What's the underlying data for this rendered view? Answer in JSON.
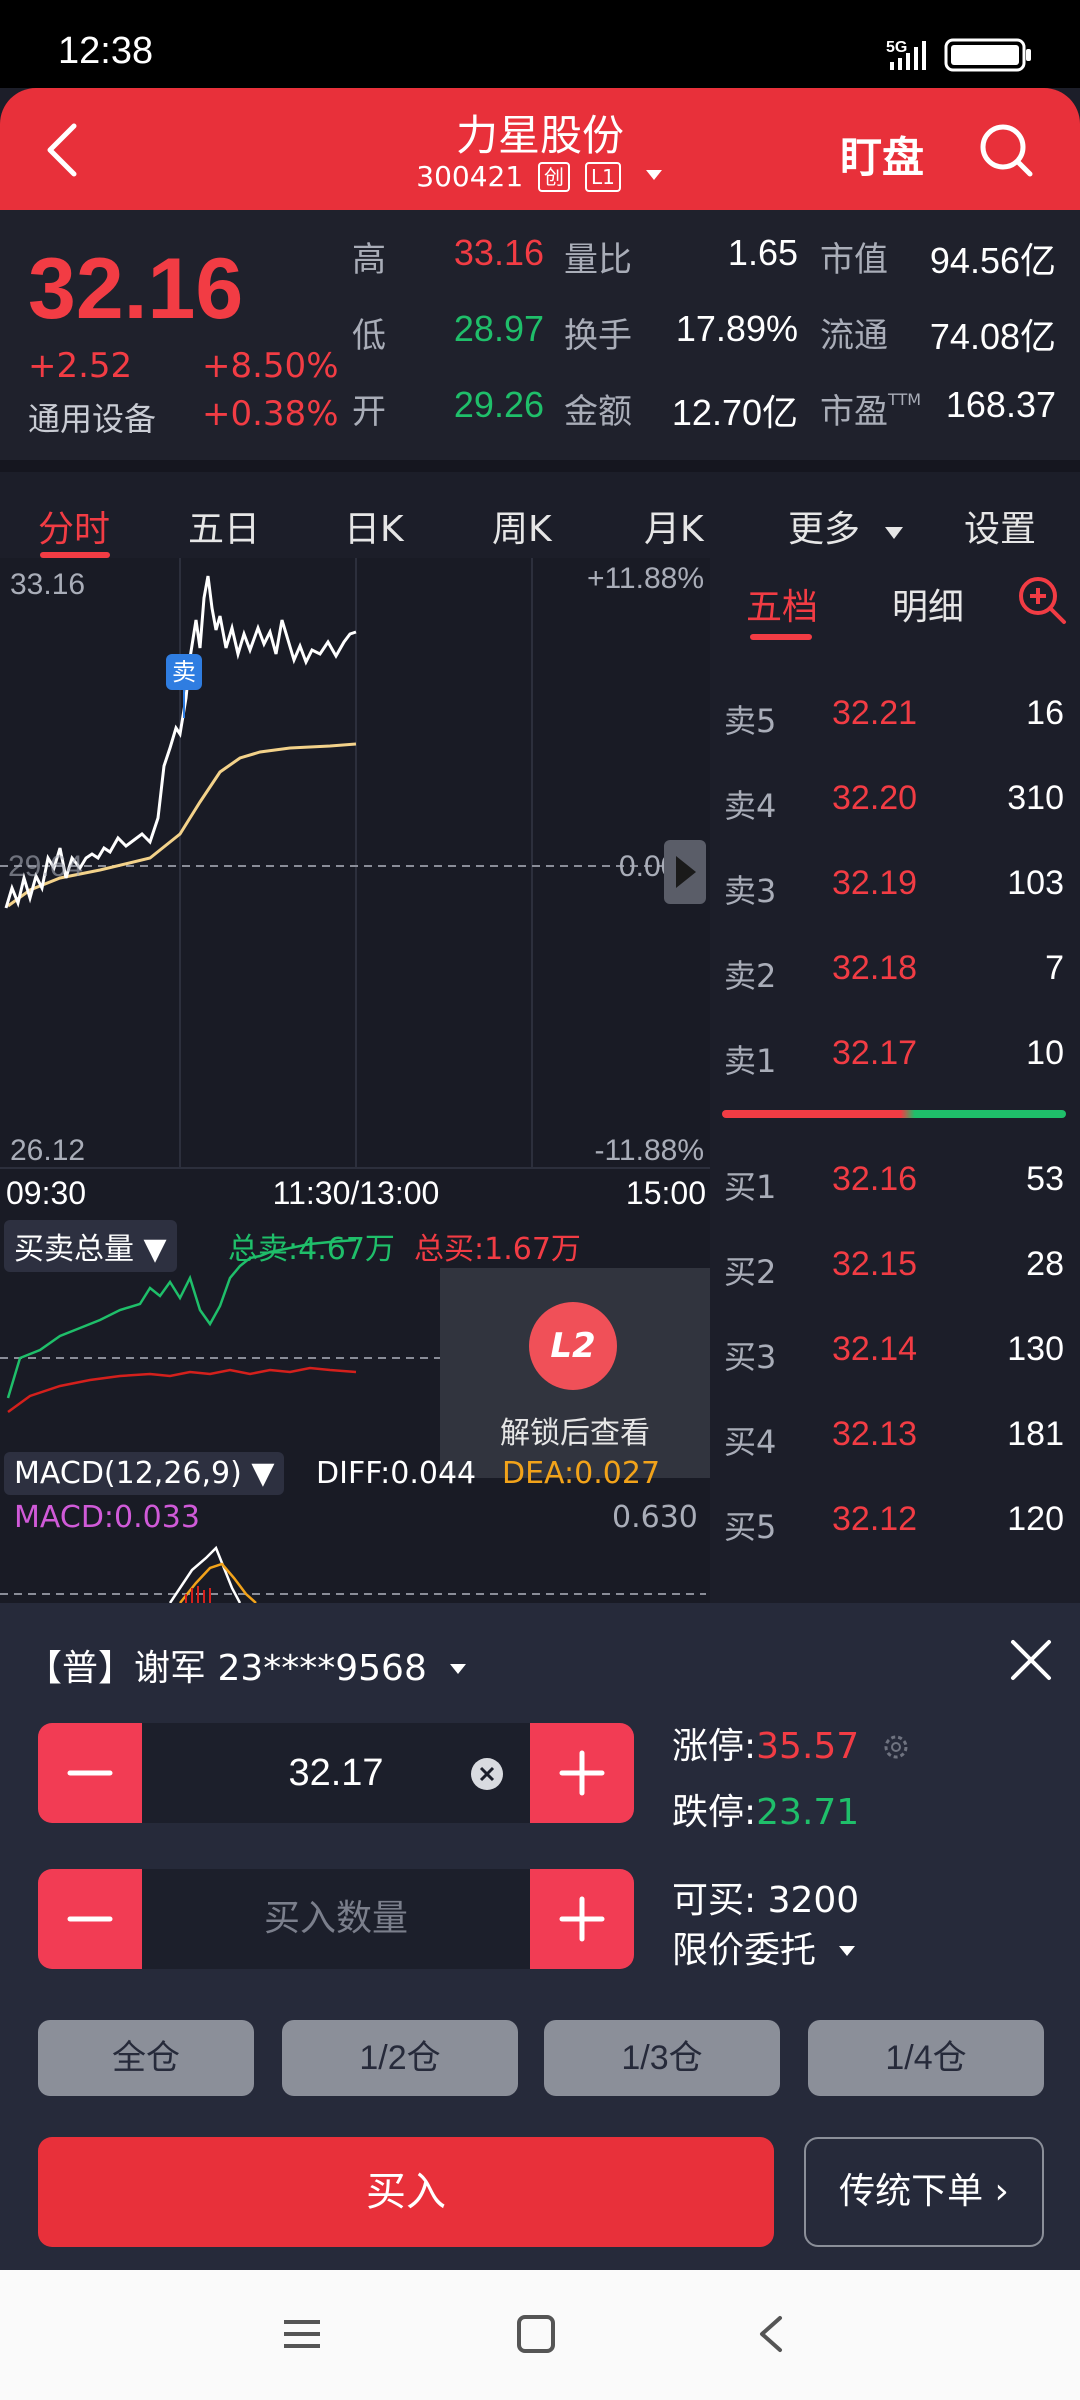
{
  "status_bar": {
    "time": "12:38",
    "network": "5G"
  },
  "header": {
    "stock_name": "力星股份",
    "stock_code": "300421",
    "tag1": "创",
    "tag2": "L1",
    "watch_label": "盯盘"
  },
  "quote": {
    "last_price": "32.16",
    "change_abs": "+2.52",
    "change_pct": "+8.50%",
    "sector_name": "通用设备",
    "sector_pct": "+0.38%",
    "rows": [
      [
        {
          "label": "高",
          "value": "33.16",
          "color": "red"
        },
        {
          "label": "量比",
          "value": "1.65",
          "color": "white"
        },
        {
          "label": "市值",
          "value": "94.56亿",
          "color": "white"
        }
      ],
      [
        {
          "label": "低",
          "value": "28.97",
          "color": "green"
        },
        {
          "label": "换手",
          "value": "17.89%",
          "color": "white"
        },
        {
          "label": "流通",
          "value": "74.08亿",
          "color": "white"
        }
      ],
      [
        {
          "label": "开",
          "value": "29.26",
          "color": "green"
        },
        {
          "label": "金额",
          "value": "12.70亿",
          "color": "white"
        },
        {
          "label": "市盈",
          "value": "168.37",
          "color": "white"
        }
      ]
    ],
    "pe_suffix": "TTM"
  },
  "tabs": [
    "分时",
    "五日",
    "日K",
    "周K",
    "月K",
    "更多",
    "设置"
  ],
  "chart": {
    "price_high": "33.16",
    "price_low": "26.12",
    "pct_high": "+11.88%",
    "pct_zero": "0.00%",
    "pct_low": "-11.88%",
    "price_ref": "29.64",
    "time_start": "09:30",
    "time_mid": "11:30/13:00",
    "time_end": "15:00",
    "sell_marker": "卖",
    "volume_indicator": "买卖总量",
    "total_sell": "总卖:4.67万",
    "total_buy": "总买:1.67万",
    "lock_badge": "L2",
    "lock_text": "解锁后查看",
    "macd_label": "MACD(12,26,9)",
    "diff": "DIFF:0.044",
    "dea": "DEA:0.027",
    "macd": "MACD:0.033",
    "macd_max": "0.630"
  },
  "order_book": {
    "tab_five": "五档",
    "tab_detail": "明细",
    "asks": [
      {
        "label": "卖5",
        "price": "32.21",
        "vol": "16"
      },
      {
        "label": "卖4",
        "price": "32.20",
        "vol": "310"
      },
      {
        "label": "卖3",
        "price": "32.19",
        "vol": "103"
      },
      {
        "label": "卖2",
        "price": "32.18",
        "vol": "7"
      },
      {
        "label": "卖1",
        "price": "32.17",
        "vol": "10"
      }
    ],
    "bids": [
      {
        "label": "买1",
        "price": "32.16",
        "vol": "53"
      },
      {
        "label": "买2",
        "price": "32.15",
        "vol": "28"
      },
      {
        "label": "买3",
        "price": "32.14",
        "vol": "130"
      },
      {
        "label": "买4",
        "price": "32.13",
        "vol": "181"
      },
      {
        "label": "买5",
        "price": "32.12",
        "vol": "120"
      }
    ]
  },
  "trade": {
    "account": "【普】谢军   23****9568",
    "price_value": "32.17",
    "qty_placeholder": "买入数量",
    "limit_up_label": "涨停:",
    "limit_up_value": "35.57",
    "limit_down_label": "跌停:",
    "limit_down_value": "23.71",
    "can_buy": "可买:  3200",
    "order_type": "限价委托",
    "positions": [
      "全仓",
      "1/2仓",
      "1/3仓",
      "1/4仓"
    ],
    "buy_label": "买入",
    "classic_label": "传统下单 ›"
  },
  "colors": {
    "accent": "#e8303a",
    "up": "#f23c44",
    "down": "#1fbf6a"
  }
}
